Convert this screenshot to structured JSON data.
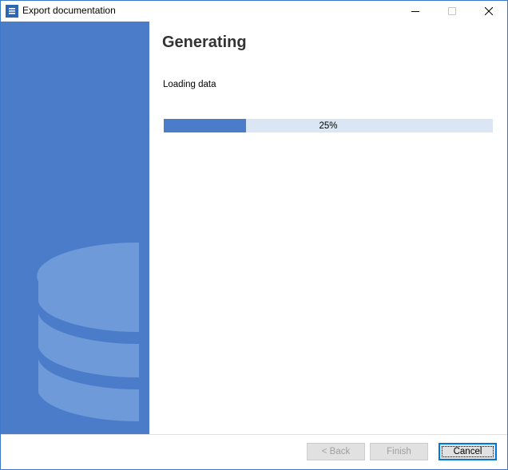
{
  "window": {
    "title": "Export documentation",
    "controls": {
      "minimize_icon": "minimize-icon",
      "maximize_icon": "maximize-icon",
      "close_icon": "close-icon"
    }
  },
  "main": {
    "heading": "Generating",
    "status": "Loading data",
    "progress": {
      "percent": 25,
      "label": "25%"
    }
  },
  "footer": {
    "back_label": "< Back",
    "finish_label": "Finish",
    "cancel_label": "Cancel"
  },
  "colors": {
    "accent": "#4a7cc9",
    "progress_track": "#dae6f3",
    "database_graphic": "#6f9ad9"
  }
}
